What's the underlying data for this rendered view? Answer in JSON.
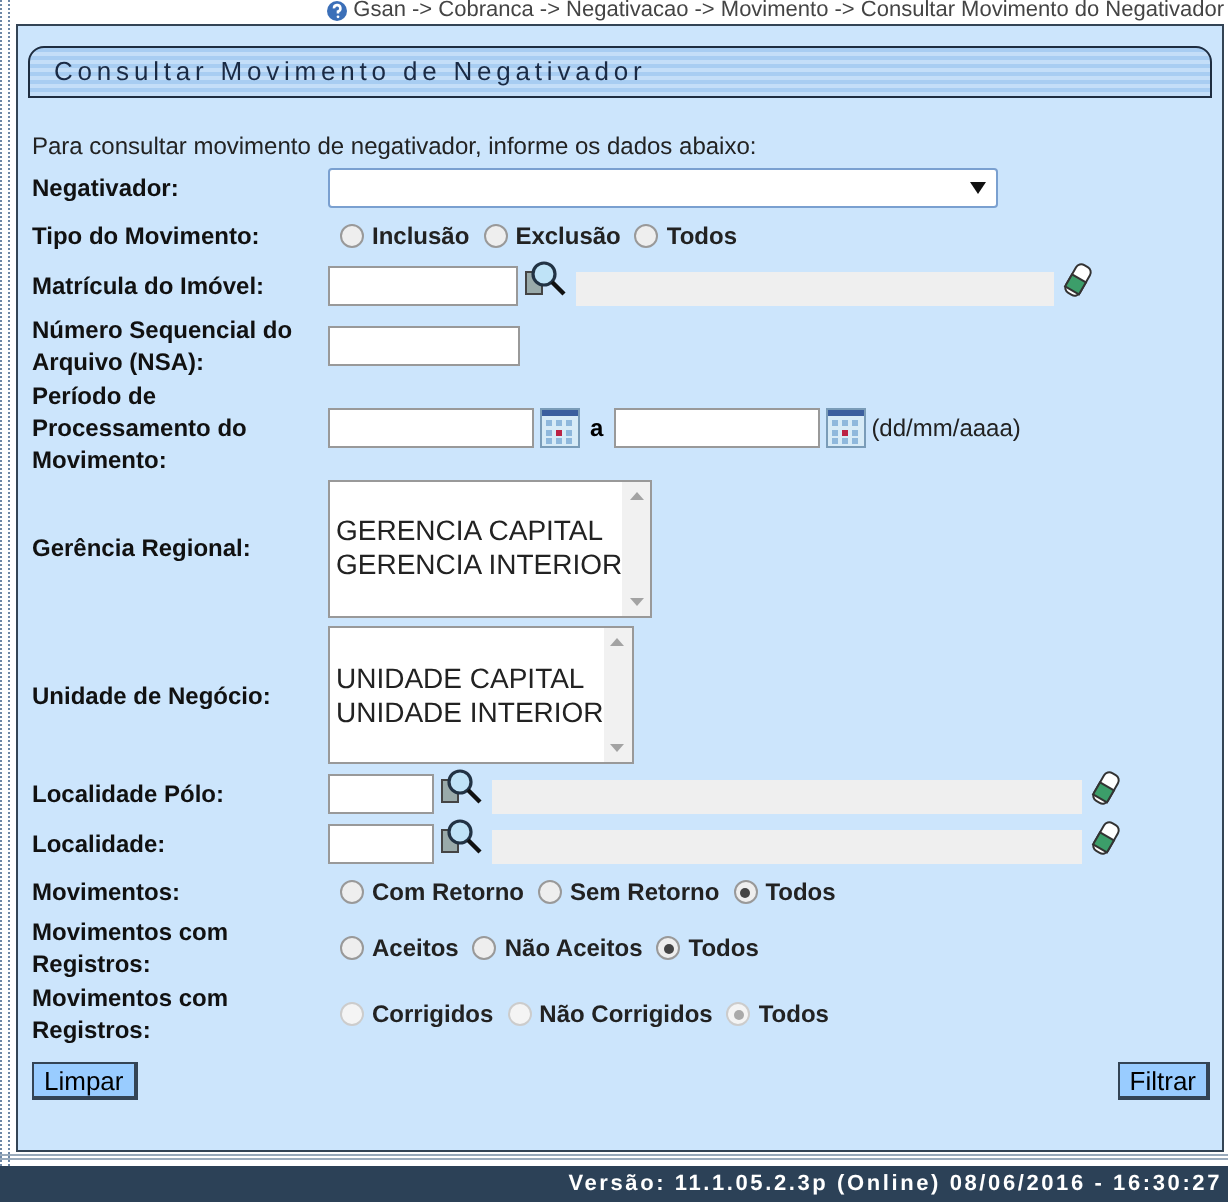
{
  "breadcrumb": "Gsan -> Cobranca -> Negativacao -> Movimento -> Consultar Movimento do Negativador",
  "panel_title": "Consultar Movimento de Negativador",
  "intro": "Para consultar movimento de negativador, informe os dados abaixo:",
  "fields": [
    {
      "kind": "select",
      "label": "Negativador:"
    },
    {
      "kind": "radio",
      "label": "Tipo do Movimento:",
      "disabled": false,
      "options": [
        {
          "label": "Inclusão",
          "selected": false
        },
        {
          "label": "Exclusão",
          "selected": false
        },
        {
          "label": "Todos",
          "selected": false
        }
      ]
    },
    {
      "kind": "lookup",
      "label": "Matrícula do Imóvel:"
    },
    {
      "kind": "text",
      "label": "Número Sequencial do Arquivo (NSA):"
    },
    {
      "kind": "daterange",
      "label": "Período de Processamento do Movimento:",
      "separator": "a",
      "hint": "(dd/mm/aaaa)"
    },
    {
      "kind": "listbox",
      "label": "Gerência Regional:",
      "options": [
        "GERENCIA CAPITAL",
        "GERENCIA INTERIOR"
      ]
    },
    {
      "kind": "listbox",
      "label": "Unidade de Negócio:",
      "options": [
        "UNIDADE CAPITAL",
        "UNIDADE INTERIOR"
      ]
    },
    {
      "kind": "lookup",
      "label": "Localidade Pólo:"
    },
    {
      "kind": "lookup",
      "label": "Localidade:"
    },
    {
      "kind": "radio",
      "label": "Movimentos:",
      "disabled": false,
      "options": [
        {
          "label": "Com Retorno",
          "selected": false
        },
        {
          "label": "Sem Retorno",
          "selected": false
        },
        {
          "label": "Todos",
          "selected": true
        }
      ]
    },
    {
      "kind": "radio",
      "label": "Movimentos com Registros:",
      "disabled": false,
      "options": [
        {
          "label": "Aceitos",
          "selected": false
        },
        {
          "label": "Não Aceitos",
          "selected": false
        },
        {
          "label": "Todos",
          "selected": true
        }
      ]
    },
    {
      "kind": "radio",
      "label": "Movimentos com Registros:",
      "disabled": true,
      "options": [
        {
          "label": "Corrigidos",
          "selected": false
        },
        {
          "label": "Não Corrigidos",
          "selected": false
        },
        {
          "label": "Todos",
          "selected": true
        }
      ]
    }
  ],
  "buttons": [
    "Limpar",
    "Filtrar"
  ],
  "footer": "Versão: 11.1.05.2.3p (Online) 08/06/2016 - 16:30:27"
}
